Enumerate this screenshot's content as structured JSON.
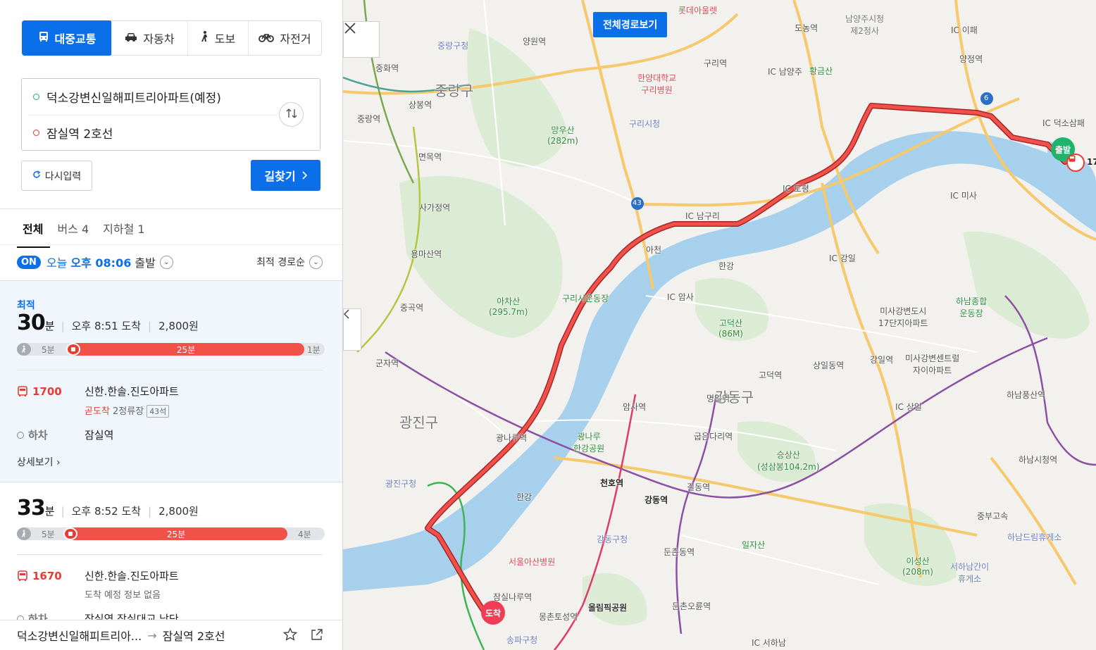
{
  "modes": [
    {
      "label": "대중교통",
      "icon": "bus-icon"
    },
    {
      "label": "자동차",
      "icon": "car-icon"
    },
    {
      "label": "도보",
      "icon": "walk-icon"
    },
    {
      "label": "자전거",
      "icon": "bicycle-icon"
    }
  ],
  "route": {
    "origin": "덕소강변신일해피트리아파트(예정)",
    "destination": "잠실역 2호선"
  },
  "buttons": {
    "reset": "다시입력",
    "search": "길찾기"
  },
  "result_tabs": [
    "전체",
    "버스 4",
    "지하철 1"
  ],
  "departure": {
    "on": "ON",
    "prefix": "오늘",
    "time": "오후 08:06",
    "suffix": "출발",
    "sort": "최적 경로순"
  },
  "results": [
    {
      "badge": "최적",
      "minutes": "30",
      "unit": "분",
      "arrival": "오후 8:51 도착",
      "fare": "2,800원",
      "walk_start": "5분",
      "ride": "25분",
      "walk_end": "1분",
      "bus": "1700",
      "board_stop": "신한.한솔.진도아파트",
      "status_red": "곧도착",
      "status": "2정류장",
      "seats": "43석",
      "off_label": "하차",
      "off_stop": "잠실역",
      "detail": "상세보기"
    },
    {
      "minutes": "33",
      "unit": "분",
      "arrival": "오후 8:52 도착",
      "fare": "2,800원",
      "walk_start": "5분",
      "ride": "25분",
      "walk_end": "4분",
      "bus": "1670",
      "board_stop": "신한.한솔.진도아파트",
      "status": "도착 예정 정보 없음",
      "off_label": "하차",
      "off_stop": "잠실역.잠실대교 남단"
    }
  ],
  "bottom": {
    "origin": "덕소강변신일해피트리아...",
    "destination": "잠실역 2호선"
  },
  "map": {
    "overview_button": "전체경로보기",
    "start_pin": "출발",
    "end_pin": "도착",
    "labels": {
      "jungnang": "중랑구",
      "gwangjin": "광진구",
      "gangdong": "강동구",
      "hangang1": "한강",
      "hangang2": "한강",
      "mangusan": "망우산",
      "mangusan_h": "(282m)",
      "achasan": "아차산",
      "achasan_h": "(295.7m)",
      "godeoksan": "고덕산",
      "godeoksan_h": "(86M)",
      "seungsangsan": "승상산",
      "seungsangsan_h": "(성삼봉104.2m)",
      "ilja": "일자산",
      "iseong": "이성산",
      "iseong_h": "(208m)",
      "hwanggeum": "황금산",
      "guri_city": "구리시청",
      "jungnang_office": "중랑구청",
      "gwangjin_office": "광진구청",
      "gangdong_office": "강동구청",
      "songpa_office": "송파구청",
      "hanyang_hosp": "한양대학교",
      "hanyang_hosp2": "구리병원",
      "asan_hosp": "서울아산병원",
      "olympic": "올림픽공원",
      "guri_stadium": "구리시운동장",
      "gwangnaru_park": "광나루",
      "gwangnaru_park2": "한강공원",
      "hanam_stadium": "하남종합",
      "hanam_stadium2": "운동장",
      "misa": "미사강변도시",
      "misa2": "17단지아파트",
      "misa_central": "미사강변센트럴",
      "misa_central2": "자이아파트",
      "hanam_rest": "하남드림휴게소",
      "seohanam_rest": "서하남간이",
      "seohanam_rest2": "휴게소",
      "jungbu": "중부고속",
      "namyangju": "남양주시청",
      "namyangju2": "제2청사",
      "lotte_outlet": "롯데아울렛",
      "st_junghwa": "중화역",
      "st_sangbong": "상봉역",
      "st_jungnang": "중랑역",
      "st_yangwon": "양원역",
      "st_guri": "구리역",
      "st_myeonmok": "면목역",
      "st_sagajeong": "사가정역",
      "st_yongmasan": "용마산역",
      "st_junggok": "중곡역",
      "st_gunja": "군자역",
      "st_gwangnaru": "광나루역",
      "st_cheonho": "천호역",
      "st_gangdong": "강동역",
      "st_amsa": "암사역",
      "st_myeongil": "명일역",
      "st_gubeundari": "굽은다리역",
      "st_gildong": "길동역",
      "st_dunchon": "둔촌동역",
      "st_dunchon_oryun": "둔촌오륜역",
      "st_mongchon": "몽촌토성역",
      "st_jamsilnaru": "잠실나루역",
      "st_godeok": "고덕역",
      "st_sangil": "상일동역",
      "st_gangil": "강일역",
      "st_hanam_pungsan": "하남풍산역",
      "st_hanam_city": "하남시청역",
      "st_yangjeong": "양정역",
      "st_dosim": "도농역",
      "ic_namyangju": "IC 남양주",
      "ic_guri": "IC 남구리",
      "ic_amsa": "IC 암사",
      "ic_gangil": "IC 강일",
      "ic_sangil": "IC 상일",
      "ic_misa": "IC 미사",
      "ic_toji": "IC 토평",
      "ic_seohanam": "IC 서하남",
      "ic_deokso": "IC 덕소삼패",
      "ic_ipae": "IC 이패",
      "achun": "아천",
      "route_43": "43",
      "route_6": "6",
      "route_17": "17"
    }
  }
}
